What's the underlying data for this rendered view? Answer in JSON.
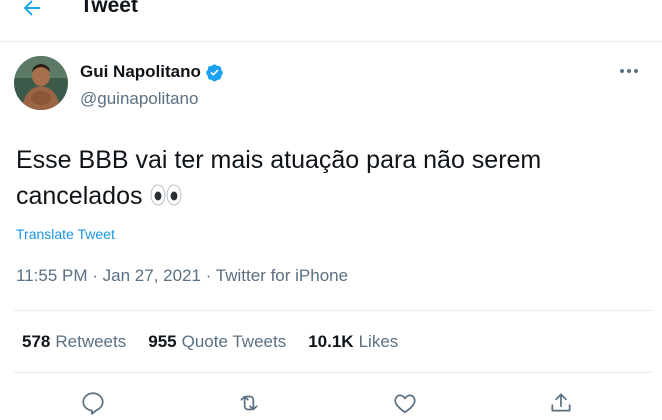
{
  "header": {
    "title": "Tweet",
    "back_icon": "arrow-left-icon"
  },
  "author": {
    "display_name": "Gui Napolitano",
    "handle": "@guinapolitano",
    "verified": true,
    "verified_icon": "verified-badge-icon",
    "avatar_icon": "avatar"
  },
  "tweet": {
    "text": "Esse BBB vai ter mais atuação para não serem cancelados",
    "emoji": "👀",
    "translate_label": "Translate Tweet",
    "time": "11:55 PM",
    "date": "Jan 27, 2021",
    "source": "Twitter for iPhone",
    "separator": "·"
  },
  "stats": {
    "retweets_count": "578",
    "retweets_label": "Retweets",
    "quotes_count": "955",
    "quotes_label": "Quote Tweets",
    "likes_count": "10.1K",
    "likes_label": "Likes"
  },
  "actions": [
    "reply-icon",
    "retweet-icon",
    "like-icon",
    "share-icon"
  ],
  "colors": {
    "accent": "#1da1f2",
    "link": "#1b95e0",
    "muted": "#5b7083",
    "divider": "#e6ecf0",
    "text": "#0f1419"
  }
}
